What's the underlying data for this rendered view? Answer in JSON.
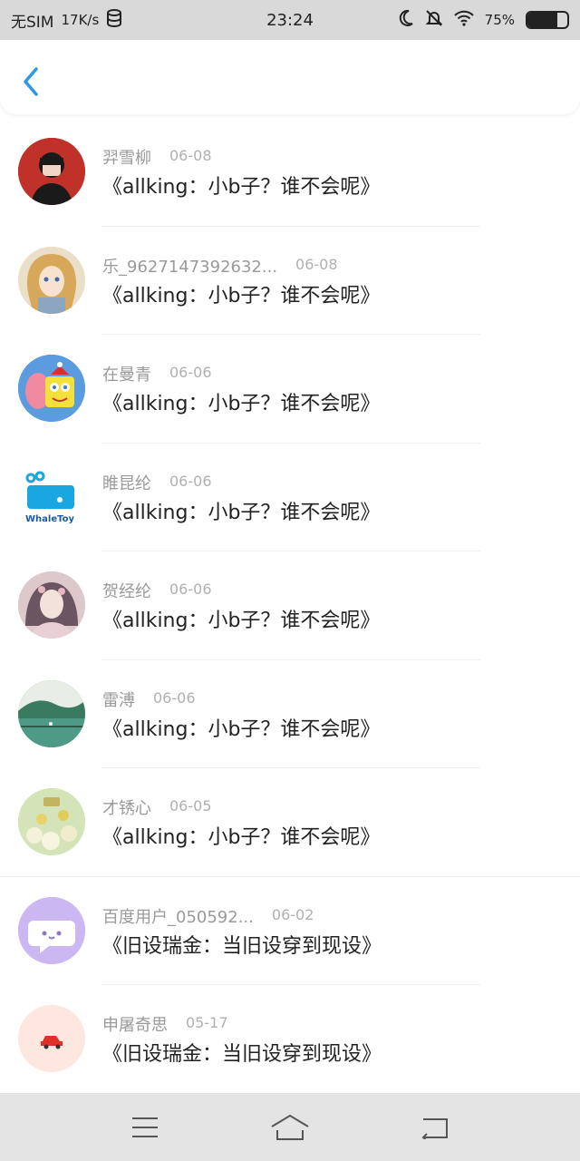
{
  "status_bar": {
    "carrier": "无SIM",
    "net_speed": "17K/s",
    "time": "23:24",
    "battery_text": "75%",
    "battery_level": 0.75
  },
  "nav": {
    "back_icon": "chevron-left-icon",
    "accent": "#2a9ae8"
  },
  "items": [
    {
      "name": "羿雪柳",
      "date": "06-08",
      "title": "《allking：小b子？谁不会呢》",
      "avatar": "girl-red"
    },
    {
      "name": "乐_9627147392632...",
      "date": "06-08",
      "title": "《allking：小b子？谁不会呢》",
      "avatar": "anime-girl"
    },
    {
      "name": "在曼青",
      "date": "06-06",
      "title": "《allking：小b子？谁不会呢》",
      "avatar": "spongebob"
    },
    {
      "name": "睢昆纶",
      "date": "06-06",
      "title": "《allking：小b子？谁不会呢》",
      "avatar": "whaletoy",
      "logo_text": "WhaleToy"
    },
    {
      "name": "贺经纶",
      "date": "06-06",
      "title": "《allking：小b子？谁不会呢》",
      "avatar": "painted-woman"
    },
    {
      "name": "雷溥",
      "date": "06-06",
      "title": "《allking：小b子？谁不会呢》",
      "avatar": "lake"
    },
    {
      "name": "才锈心",
      "date": "06-05",
      "title": "《allking：小b子？谁不会呢》",
      "avatar": "flowers"
    },
    {
      "name": "百度用户_050592...",
      "date": "06-02",
      "title": "《旧设瑞金：当旧设穿到现设》",
      "avatar": "chat-purple"
    },
    {
      "name": "申屠奇思",
      "date": "05-17",
      "title": "《旧设瑞金：当旧设穿到现设》",
      "avatar": "car-peach"
    }
  ],
  "bottom_nav": {
    "menu_icon": "menu-icon",
    "home_icon": "home-icon",
    "back_icon": "back-arrow-icon"
  }
}
